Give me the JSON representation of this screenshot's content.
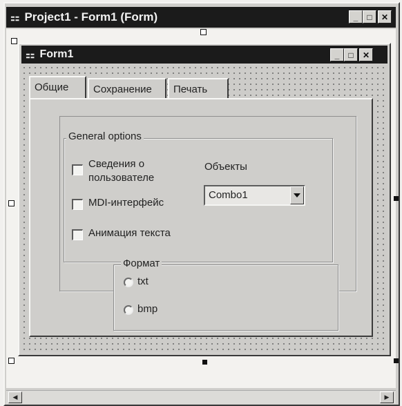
{
  "project_window": {
    "title": "Project1 - Form1 (Form)",
    "buttons": {
      "minimize": "_",
      "maximize": "□",
      "close": "✕"
    }
  },
  "form_window": {
    "title": "Form1",
    "buttons": {
      "minimize": "_",
      "maximize": "□",
      "close": "✕"
    }
  },
  "tabs": [
    {
      "label": "Общие",
      "selected": true
    },
    {
      "label": "Сохранение",
      "selected": false
    },
    {
      "label": "Печать",
      "selected": false
    }
  ],
  "general_options": {
    "legend": "General options",
    "checkboxes": [
      {
        "label_line1": "Сведения о",
        "label_line2": "пользователе",
        "checked": false
      },
      {
        "label": "MDI-интерфейс",
        "checked": false
      },
      {
        "label": "Анимация текста",
        "checked": false
      }
    ],
    "objects_label": "Объекты",
    "combo_value": "Combo1"
  },
  "format": {
    "legend": "Формат",
    "options": [
      {
        "label": "txt",
        "selected": false
      },
      {
        "label": "bmp",
        "selected": false
      }
    ]
  },
  "scrollbar": {
    "left_arrow": "◀",
    "right_arrow": "▶"
  },
  "colors": {
    "titlebar": "#1b1b1b",
    "face": "#cfcecb"
  }
}
